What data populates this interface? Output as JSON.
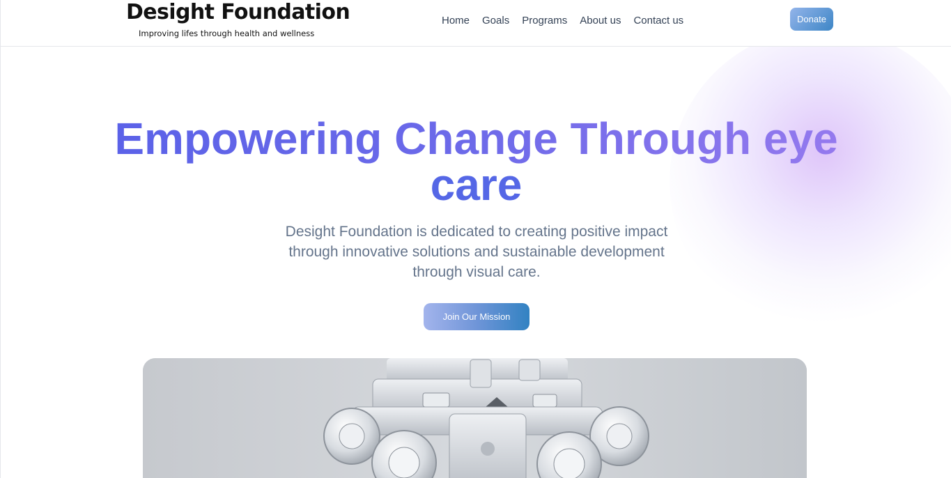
{
  "header": {
    "logo_title": "Desight Foundation",
    "logo_tagline": "Improving lifes through health and wellness",
    "nav": [
      {
        "label": "Home"
      },
      {
        "label": "Goals"
      },
      {
        "label": "Programs"
      },
      {
        "label": "About us"
      },
      {
        "label": "Contact us"
      }
    ],
    "donate_label": "Donate"
  },
  "hero": {
    "title_line1": "Empowering Change Through eye",
    "title_line2": "care",
    "subtitle": "Desight Foundation is dedicated to creating positive impact through innovative solutions and sustainable development through visual care.",
    "cta_label": "Join Our Mission",
    "image_subject": "phoropter-eye-exam-equipment"
  },
  "colors": {
    "accent_blue": "#5b62e8",
    "accent_purple": "#9479ee",
    "button_gradient_start": "#a3b4ec",
    "button_gradient_end": "#3282c2",
    "text_muted": "#64748b"
  }
}
